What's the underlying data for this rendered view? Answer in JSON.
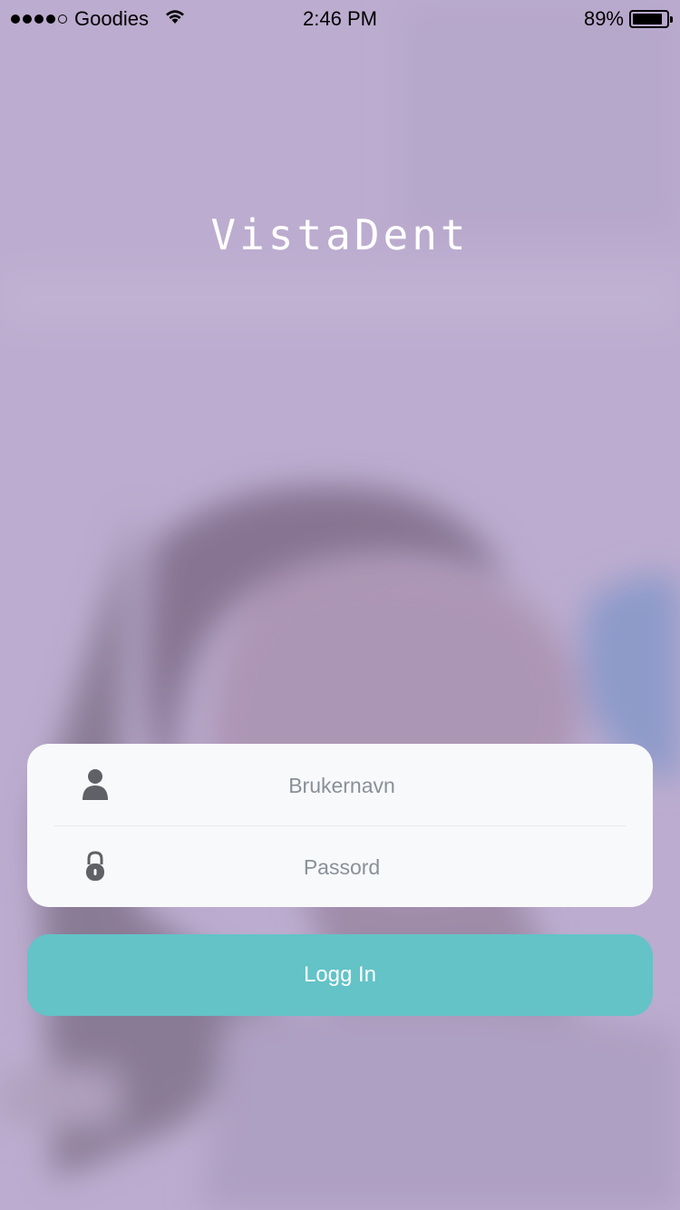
{
  "status_bar": {
    "carrier": "Goodies",
    "time": "2:46 PM",
    "battery_percent": "89%",
    "battery_level": 0.89,
    "signal_bars_filled": 4,
    "signal_bars_total": 5,
    "wifi_icon": "wifi-icon"
  },
  "app": {
    "logo_text": "VistaDent"
  },
  "login_form": {
    "username": {
      "icon": "user-icon",
      "placeholder": "Brukernavn",
      "value": ""
    },
    "password": {
      "icon": "lock-icon",
      "placeholder": "Passord",
      "value": ""
    },
    "submit_label": "Logg In"
  },
  "colors": {
    "overlay_tint": "#b8a9c9",
    "card_background": "#f8f9fb",
    "button_background": "#63c3c7",
    "icon_color": "#5f6166",
    "placeholder_color": "#8a9097"
  }
}
